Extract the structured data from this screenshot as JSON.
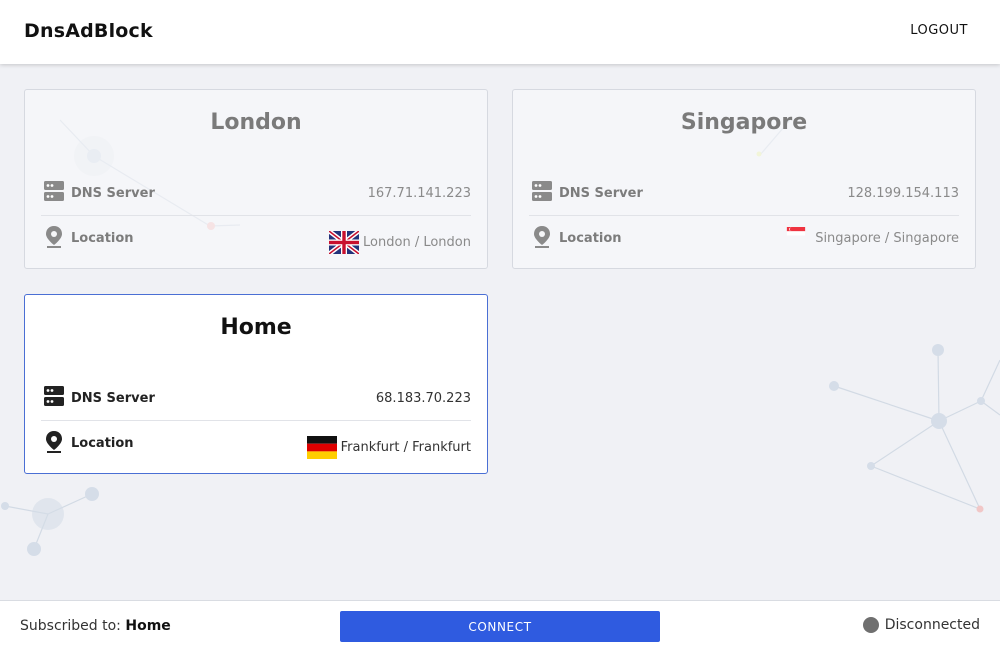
{
  "header": {
    "brand": "DnsAdBlock",
    "logout_label": "LOGOUT"
  },
  "servers": [
    {
      "name": "London",
      "dns_label": "DNS Server",
      "dns_value": "167.71.141.223",
      "location_label": "Location",
      "location_value": "London / London",
      "flag": "uk-flag-icon",
      "active": false
    },
    {
      "name": "Singapore",
      "dns_label": "DNS Server",
      "dns_value": "128.199.154.113",
      "location_label": "Location",
      "location_value": "Singapore / Singapore",
      "flag": "singapore-flag-icon",
      "active": false
    },
    {
      "name": "Home",
      "dns_label": "DNS Server",
      "dns_value": "68.183.70.223",
      "location_label": "Location",
      "location_value": "Frankfurt / Frankfurt",
      "flag": "germany-flag-icon",
      "active": true
    }
  ],
  "footer": {
    "subscribed_label": "Subscribed to:",
    "subscribed_value": "Home",
    "connect_label": "CONNECT",
    "status_label": "Disconnected"
  },
  "colors": {
    "accent": "#2f5be0",
    "active_border": "#4a6fd4",
    "status_disconnected": "#6f6f6f",
    "background": "#f0f1f5"
  }
}
